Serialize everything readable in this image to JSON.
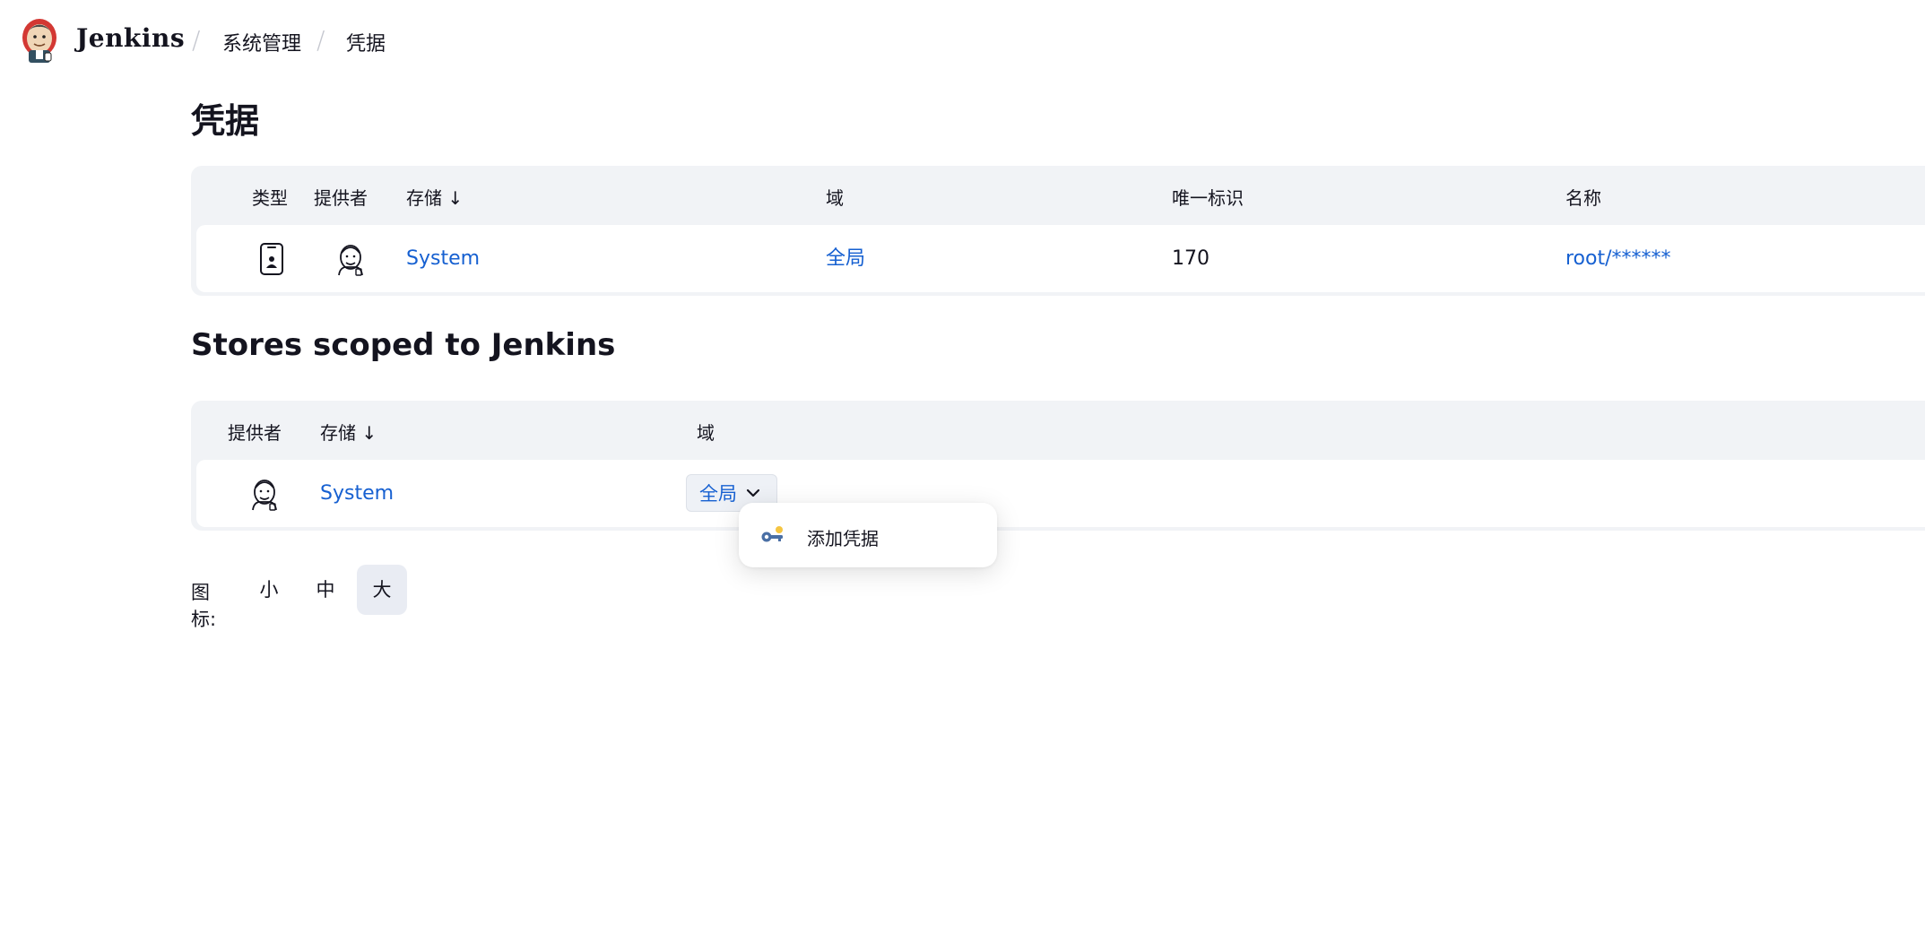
{
  "header": {
    "brand": "Jenkins",
    "breadcrumbs": [
      "系统管理",
      "凭据"
    ]
  },
  "credentials": {
    "title": "凭据",
    "columns": {
      "type": "类型",
      "provider": "提供者",
      "store": "存储 ↓",
      "domain": "域",
      "id": "唯一标识",
      "name": "名称"
    },
    "rows": [
      {
        "type_icon": "mobile-credential-icon",
        "provider_icon": "jenkins-provider-icon",
        "store": "System",
        "domain": "全局",
        "id": "170",
        "name": "root/******"
      }
    ]
  },
  "stores": {
    "title": "Stores scoped to Jenkins",
    "columns": {
      "provider": "提供者",
      "store": "存储 ↓",
      "domain": "域"
    },
    "rows": [
      {
        "provider_icon": "jenkins-provider-icon",
        "store": "System",
        "domain": "全局"
      }
    ]
  },
  "dropdown": {
    "open": true,
    "items": [
      {
        "icon": "add-credential-key-icon",
        "label": "添加凭据"
      }
    ]
  },
  "icon_size": {
    "label": "图标:",
    "options": [
      "小",
      "中",
      "大"
    ],
    "selected": "大"
  },
  "colors": {
    "link": "#1660d1",
    "table_bg": "#f1f3f6",
    "active_bg": "#e9ecf3"
  }
}
